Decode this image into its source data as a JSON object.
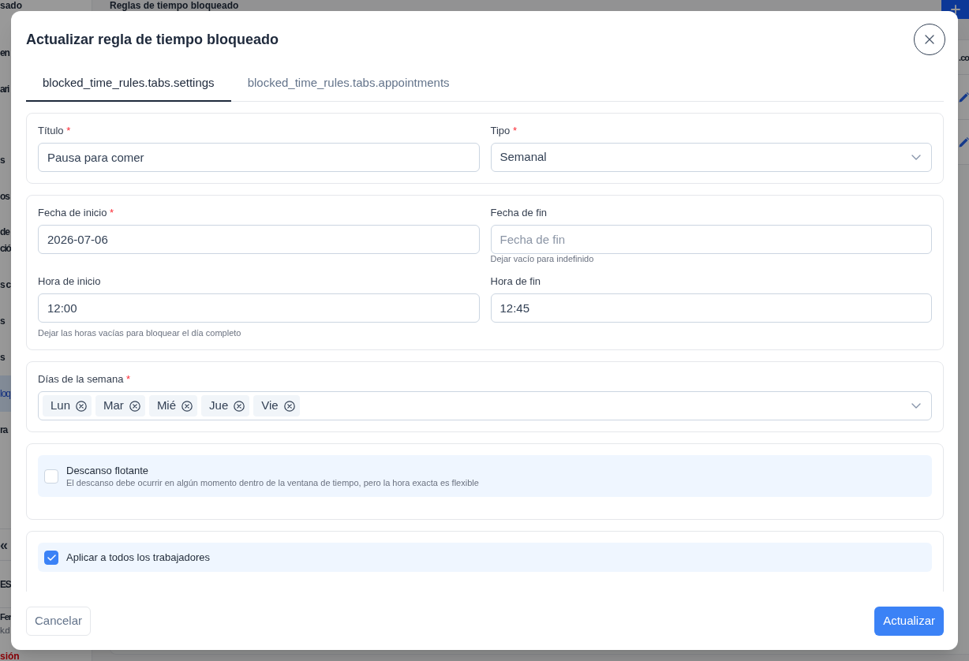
{
  "background": {
    "sidebar": {
      "brand": "sado",
      "groups": [
        {
          "items": [
            {
              "lines": [
                "en"
              ],
              "selected": false
            },
            {
              "lines": [
                "ari"
              ],
              "selected": false
            }
          ]
        },
        {
          "items": [
            {
              "lines": [
                "s"
              ],
              "selected": false
            },
            {
              "lines": [
                "os"
              ],
              "selected": false
            },
            {
              "lines": [
                "de",
                "ció"
              ],
              "selected": false
            },
            {
              "lines": [
                "s c"
              ],
              "selected": false
            },
            {
              "lines": [
                "s"
              ],
              "selected": false
            },
            {
              "lines": [
                "s"
              ],
              "selected": false
            },
            {
              "lines": [
                "loq"
              ],
              "selected": true
            },
            {
              "lines": [
                "ra"
              ],
              "selected": false
            }
          ]
        }
      ],
      "collapse_glyph": "«",
      "section_label": "ES",
      "user": {
        "name": "Fer",
        "email": "k.d"
      },
      "logout": "sión"
    },
    "page_title": "Reglas de tiempo bloqueado",
    "table": {
      "rows": [
        {
          "kind": "text",
          "text": ".co"
        },
        {
          "kind": "edit"
        },
        {
          "kind": "edit"
        }
      ]
    }
  },
  "dialog": {
    "title": "Actualizar regla de tiempo bloqueado",
    "required_mark": "*",
    "tabs": [
      {
        "label": "blocked_time_rules.tabs.settings",
        "selected": true
      },
      {
        "label": "blocked_time_rules.tabs.appointments",
        "selected": false
      }
    ],
    "sections": [
      {
        "fields": [
          {
            "kind": "text",
            "label": "Título",
            "required": true,
            "value": "Pausa para comer"
          },
          {
            "kind": "select",
            "label": "Tipo",
            "required": true,
            "value": "Semanal"
          }
        ]
      },
      {
        "fields": [
          {
            "kind": "text",
            "label": "Fecha de inicio",
            "required": true,
            "value": "2026-07-06"
          },
          {
            "kind": "text",
            "label": "Fecha de fin",
            "required": false,
            "placeholder": "Fecha de fin",
            "hint": "Dejar vacío para indefinido"
          },
          {
            "kind": "text",
            "label": "Hora de inicio",
            "required": false,
            "value": "12:00"
          },
          {
            "kind": "text",
            "label": "Hora de fin",
            "required": false,
            "value": "12:45"
          }
        ],
        "note": "Dejar las horas vacías para bloquear el día completo"
      },
      {
        "fields": [
          {
            "kind": "multiselect",
            "label": "Días de la semana",
            "required": true,
            "chips": [
              "Lun",
              "Mar",
              "Mié",
              "Jue",
              "Vie"
            ]
          }
        ]
      }
    ],
    "options": [
      {
        "label": "Descanso flotante",
        "description": "El descanso debe ocurrir en algún momento dentro de la ventana de tiempo, pero la hora exacta es flexible",
        "checked": false
      },
      {
        "label": "Aplicar a todos los trabajadores",
        "checked": true
      }
    ],
    "buttons": [
      {
        "kind": "secondary",
        "label": "Cancelar"
      },
      {
        "kind": "primary",
        "label": "Actualizar"
      }
    ]
  }
}
